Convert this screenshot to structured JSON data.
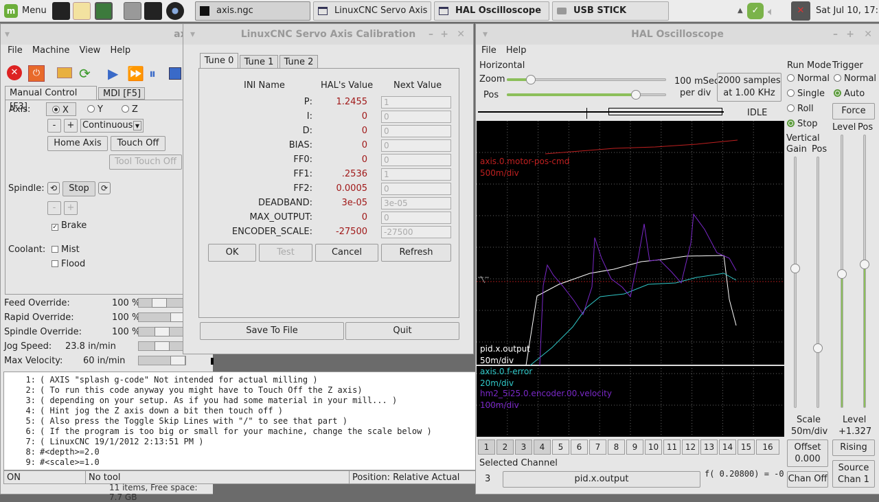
{
  "taskbar": {
    "menu_label": "Menu",
    "tasks": [
      {
        "label": "axis.ngc"
      },
      {
        "label": "LinuxCNC Servo Axis ..."
      },
      {
        "label": "HAL Oscilloscope"
      },
      {
        "label": "USB STICK"
      }
    ],
    "clock": "Sat Jul 10, 17:22"
  },
  "axis": {
    "title": "axis.n",
    "menu": [
      "File",
      "Machine",
      "View",
      "Help"
    ],
    "tabs": [
      "Manual Control [F3]",
      "MDI [F5]"
    ],
    "axis_label": "Axis:",
    "axes": [
      "X",
      "Y",
      "Z"
    ],
    "selected_axis": "X",
    "jog_minus": "-",
    "jog_plus": "+",
    "jog_mode": "Continuous",
    "home_axis": "Home Axis",
    "touch_off": "Touch Off",
    "tool_touch_off": "Tool Touch Off",
    "spindle_label": "Spindle:",
    "spindle_stop": "Stop",
    "spindle_minus": "-",
    "spindle_plus": "+",
    "brake": "Brake",
    "coolant_label": "Coolant:",
    "mist": "Mist",
    "flood": "Flood",
    "overrides": [
      {
        "label": "Feed Override:",
        "value": "100 %",
        "level": 0.42
      },
      {
        "label": "Rapid Override:",
        "value": "100 %",
        "level": 1.0
      },
      {
        "label": "Spindle Override:",
        "value": "100 %",
        "level": 0.5
      }
    ],
    "jog_speed": {
      "label": "Jog Speed:",
      "value": "23.8 in/min",
      "level": 0.5
    },
    "max_velocity": {
      "label": "Max Velocity:",
      "value": "60 in/min",
      "level": 1.0
    },
    "code": [
      {
        "n": "1:",
        "t": "( AXIS \"splash g-code\" Not intended for actual milling )"
      },
      {
        "n": "2:",
        "t": "( To run this code anyway you might have to Touch Off the Z axis)"
      },
      {
        "n": "3:",
        "t": "( depending on your setup. As if you had some material in your mill... )"
      },
      {
        "n": "4:",
        "t": "( Hint jog the Z axis down a bit then touch off )"
      },
      {
        "n": "5:",
        "t": "( Also press the Toggle Skip Lines with \"/\" to see that part )"
      },
      {
        "n": "6:",
        "t": "( If the program is too big or small for your machine, change the scale below )"
      },
      {
        "n": "7:",
        "t": "( LinuxCNC 19/1/2012 2:13:51 PM )"
      },
      {
        "n": "8:",
        "t": "#<depth>=2.0"
      },
      {
        "n": "9:",
        "t": "#<scale>=1.0"
      }
    ],
    "status": {
      "state": "ON",
      "tool": "No tool",
      "position": "Position: Relative Actual"
    },
    "behind_text": "11 items, Free space: 7.7 GB"
  },
  "calib": {
    "title": "LinuxCNC Servo Axis Calibration",
    "tabs": [
      "Tune 0",
      "Tune 1",
      "Tune 2"
    ],
    "col_ini": "INI Name",
    "col_hal": "HAL's Value",
    "col_next": "Next Value",
    "rows": [
      {
        "name": "P:",
        "hal": "1.2455",
        "next": "1",
        "red": true
      },
      {
        "name": "I:",
        "hal": "0",
        "next": "0",
        "red": true
      },
      {
        "name": "D:",
        "hal": "0",
        "next": "0",
        "red": true
      },
      {
        "name": "BIAS:",
        "hal": "0",
        "next": "0",
        "red": true
      },
      {
        "name": "FF0:",
        "hal": "0",
        "next": "0",
        "red": true
      },
      {
        "name": "FF1:",
        "hal": ".2536",
        "next": "1",
        "red": true
      },
      {
        "name": "FF2:",
        "hal": "0.0005",
        "next": "0",
        "red": true
      },
      {
        "name": "DEADBAND:",
        "hal": "3e-05",
        "next": "3e-05",
        "red": true
      },
      {
        "name": "MAX_OUTPUT:",
        "hal": "0",
        "next": "0",
        "red": true
      },
      {
        "name": "ENCODER_SCALE:",
        "hal": "-27500",
        "next": "-27500",
        "red": true
      }
    ],
    "ok": "OK",
    "test": "Test",
    "cancel": "Cancel",
    "refresh": "Refresh",
    "save": "Save To File",
    "quit": "Quit"
  },
  "scope": {
    "title": "HAL Oscilloscope",
    "menu": [
      "File",
      "Help"
    ],
    "horizontal": "Horizontal",
    "zoom": "Zoom",
    "pos": "Pos",
    "zoom_level": 0.15,
    "pos_level": 0.81,
    "per_div_1": "100 mSec",
    "per_div_2": "per div",
    "samples_1": "2000 samples",
    "samples_2": "at 1.00 KHz",
    "state": "IDLE",
    "run_mode": "Run Mode",
    "modes": [
      "Normal",
      "Single",
      "Roll",
      "Stop"
    ],
    "selected_mode": "Stop",
    "trigger": "Trigger",
    "trig_modes": [
      "Normal",
      "Auto"
    ],
    "selected_trig": "Auto",
    "force": "Force",
    "level": "Level",
    "pos2": "Pos",
    "vertical": "Vertical",
    "gain": "Gain",
    "vpos": "Pos",
    "traces": [
      {
        "name": "axis.0.motor-pos-cmd",
        "scale": "500m/div",
        "color": "#c02020"
      },
      {
        "name": "pid.x.output",
        "scale": "50m/div",
        "color": "#ffffff"
      },
      {
        "name": "axis.0.f-error",
        "scale": "20m/div",
        "color": "#30c8c8"
      },
      {
        "name": "hm2_5i25.0.encoder.00.velocity",
        "scale": "100m/div",
        "color": "#7a28c8"
      }
    ],
    "channels": [
      "1",
      "2",
      "3",
      "4",
      "5",
      "6",
      "7",
      "8",
      "9",
      "10",
      "11",
      "12",
      "13",
      "14",
      "15",
      "16"
    ],
    "selected_channel_label": "Selected Channel",
    "selected_channel": "3",
    "channel_name": "pid.x.output",
    "formula": "f( 0.20800) = -0.",
    "scale_label": "Scale",
    "scale_value": "50m/div",
    "level_label": "Level",
    "level_value": "+1.327",
    "offset_label": "Offset",
    "offset_value": "0.000",
    "rising": "Rising",
    "chan_off": "Chan Off",
    "source_1": "Source",
    "source_2": "Chan  1"
  }
}
